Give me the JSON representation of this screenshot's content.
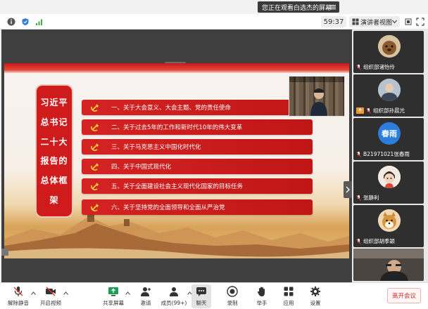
{
  "banner": {
    "text": "您正在观看白选杰的屏幕"
  },
  "topbar": {
    "timer": "59:37",
    "view_label": "演讲者视图"
  },
  "slide": {
    "title_lines": [
      "习近平",
      "总书记",
      "二十大",
      "报告的",
      "总体框",
      "架"
    ],
    "topics": [
      "一、关于大会意义、大会主题、党的责任使命",
      "二、关于过去5年的工作和新时代10年的伟大变革",
      "三、关于马克思主义中国化时代化",
      "四、关于中国式现代化",
      "五、关于全面建设社会主义现代化国家的目标任务",
      "六、关于坚持党的全面领导和全面从严治党"
    ]
  },
  "participants": [
    {
      "name": "组织部诸怡伶",
      "avatar": "dog-photo"
    },
    {
      "name": "组织部孙晨光",
      "avatar": "portrait-photo"
    },
    {
      "name": "B21971021张春雨",
      "avatar_text": "春雨"
    },
    {
      "name": "张静利",
      "avatar": "cartoon-avatar"
    },
    {
      "name": "组织部胡季颖",
      "avatar": "shiba-photo"
    }
  ],
  "toolbar": {
    "items": [
      {
        "label": "解除静音",
        "icon": "mic-muted-icon"
      },
      {
        "label": "开启视频",
        "icon": "video-off-icon"
      },
      {
        "label": "共享屏幕",
        "icon": "share-screen-icon"
      },
      {
        "label": "邀请",
        "icon": "invite-icon"
      },
      {
        "label": "成员(99+)",
        "icon": "members-icon"
      },
      {
        "label": "聊天",
        "icon": "chat-icon"
      },
      {
        "label": "录制",
        "icon": "record-icon"
      },
      {
        "label": "举手",
        "icon": "raise-hand-icon"
      },
      {
        "label": "应用",
        "icon": "apps-icon"
      },
      {
        "label": "设置",
        "icon": "settings-icon"
      }
    ],
    "leave_label": "离开会议"
  },
  "colors": {
    "slide_red": "#cf1b1b",
    "accent_blue": "#2d7ddc",
    "leave_red": "#d02f2f"
  }
}
